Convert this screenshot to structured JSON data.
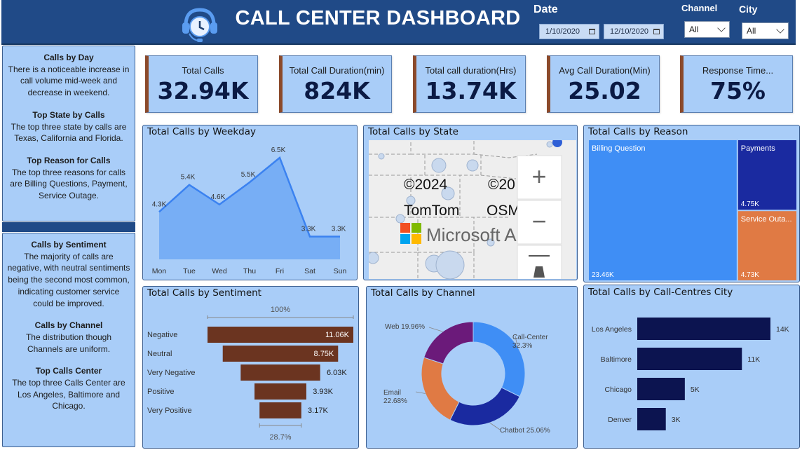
{
  "header": {
    "title": "CALL CENTER DASHBOARD",
    "date_label": "Date",
    "date_start": "1/10/2020",
    "date_end": "12/10/2020",
    "channel_label": "Channel",
    "channel_value": "All",
    "city_label": "City",
    "city_value": "All",
    "logo_icon": "headset-clock-icon"
  },
  "notes_top": [
    {
      "heading": "Calls by Day",
      "body": "There is a noticeable increase in call volume mid-week and decrease in weekend."
    },
    {
      "heading": "Top State by Calls",
      "body": "The top three state by calls are Texas, California and Florida."
    },
    {
      "heading": "Top Reason for Calls",
      "body": "The top three reasons for calls are Billing Questions, Payment, Service Outage."
    }
  ],
  "notes_bottom": [
    {
      "heading": "Calls by Sentiment",
      "body": "The majority of calls are negative, with neutral sentiments being the second most common, indicating customer service could be improved."
    },
    {
      "heading": "Calls by Channel",
      "body": "The distribution though Channels are uniform."
    },
    {
      "heading": "Top Calls Center",
      "body": "The top three Calls Center are Los Angeles, Baltimore and Chicago."
    }
  ],
  "kpis": [
    {
      "label": "Total Calls",
      "value": "32.94K"
    },
    {
      "label": "Total Call Duration(min)",
      "value": "824K"
    },
    {
      "label": "Total call duration(Hrs)",
      "value": "13.74K"
    },
    {
      "label": "Avg Call Duration(Min)",
      "value": "25.02"
    },
    {
      "label": "Response Time...",
      "value": "75%"
    }
  ],
  "map": {
    "title": "Total Calls by State",
    "copyright_1": "©2024",
    "copyright_2": "©20",
    "provider_1": "TomTom",
    "provider_2": "OSM",
    "brand": "Microsoft A",
    "zoom_in": "+",
    "zoom_out": "−"
  },
  "colors": {
    "panel": "#a9cdf8",
    "header": "#204a87",
    "area": "#5b9cf3",
    "funnel": "#6b3420",
    "bar": "#0c1450",
    "treemap_billing": "#3f8ef5",
    "treemap_payments": "#1a2aa0",
    "treemap_outage": "#e07a44"
  },
  "chart_data": [
    {
      "type": "area",
      "title": "Total Calls by Weekday",
      "categories": [
        "Mon",
        "Tue",
        "Wed",
        "Thu",
        "Fri",
        "Sat",
        "Sun"
      ],
      "values": [
        4300,
        5400,
        4600,
        5500,
        6500,
        3300,
        3300
      ],
      "labels": [
        "4.3K",
        "5.4K",
        "4.6K",
        "5.5K",
        "6.5K",
        "3.3K",
        "3.3K"
      ]
    },
    {
      "type": "treemap",
      "title": "Total Calls by Reason",
      "items": [
        {
          "name": "Billing Question",
          "value": 23460,
          "label": "23.46K"
        },
        {
          "name": "Payments",
          "value": 4750,
          "label": "4.75K"
        },
        {
          "name": "Service Outa...",
          "value": 4730,
          "label": "4.73K"
        }
      ]
    },
    {
      "type": "bar",
      "title": "Total Calls by Sentiment",
      "categories": [
        "Negative",
        "Neutral",
        "Very Negative",
        "Positive",
        "Very Positive"
      ],
      "values": [
        11060,
        8750,
        6030,
        3930,
        3170
      ],
      "labels": [
        "11.06K",
        "8.75K",
        "6.03K",
        "3.93K",
        "3.17K"
      ],
      "top_label": "100%",
      "bottom_label": "28.7%"
    },
    {
      "type": "pie",
      "title": "Total Calls by Channel",
      "slices": [
        {
          "name": "Call-Center",
          "percent": 32.3,
          "label": "32.3%",
          "color": "#3f8ef5"
        },
        {
          "name": "Chatbot",
          "percent": 25.06,
          "label": "25.06%",
          "color": "#1a2aa0"
        },
        {
          "name": "Email",
          "percent": 22.68,
          "label": "22.68%",
          "color": "#e07a44"
        },
        {
          "name": "Web",
          "percent": 19.96,
          "label": "19.96%",
          "color": "#6b1a7a"
        }
      ]
    },
    {
      "type": "bar",
      "title": "Total Calls by Call-Centres City",
      "categories": [
        "Los Angeles",
        "Baltimore",
        "Chicago",
        "Denver"
      ],
      "values": [
        14000,
        11000,
        5000,
        3000
      ],
      "labels": [
        "14K",
        "11K",
        "5K",
        "3K"
      ]
    }
  ]
}
